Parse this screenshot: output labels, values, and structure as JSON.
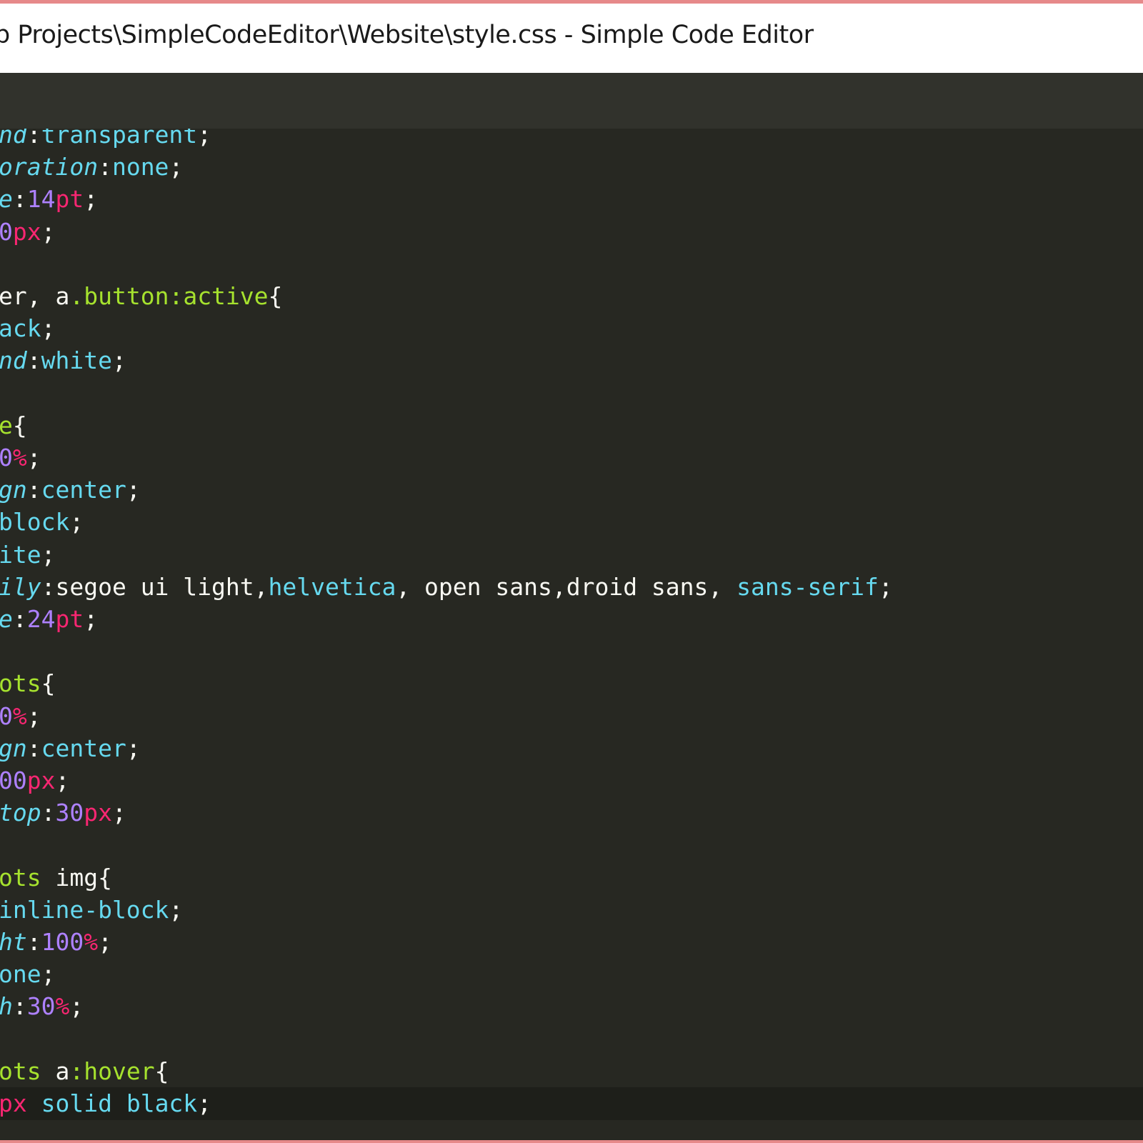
{
  "window": {
    "title": "p Projects\\SimpleCodeEditor\\Website\\style.css - Simple Code Editor"
  },
  "editor": {
    "language": "css",
    "theme_colors": {
      "background": "#272822",
      "foreground": "#f8f8f2",
      "property": "#66d9ef",
      "number": "#ae81ff",
      "unit": "#f92672",
      "selector": "#a6e22e",
      "current_line": "#1e1f1a",
      "window_border": "#e6898a"
    },
    "lines": [
      {
        "tokens": [
          {
            "t": "nd",
            "k": "prop-italic"
          },
          {
            "t": ":",
            "k": "punct"
          },
          {
            "t": "transparent",
            "k": "value"
          },
          {
            "t": ";",
            "k": "punct"
          }
        ]
      },
      {
        "tokens": [
          {
            "t": "oration",
            "k": "prop-italic"
          },
          {
            "t": ":",
            "k": "punct"
          },
          {
            "t": "none",
            "k": "value"
          },
          {
            "t": ";",
            "k": "punct"
          }
        ]
      },
      {
        "tokens": [
          {
            "t": "e",
            "k": "prop-italic"
          },
          {
            "t": ":",
            "k": "punct"
          },
          {
            "t": "14",
            "k": "num"
          },
          {
            "t": "pt",
            "k": "unit"
          },
          {
            "t": ";",
            "k": "punct"
          }
        ]
      },
      {
        "tokens": [
          {
            "t": "0",
            "k": "num"
          },
          {
            "t": "px",
            "k": "unit"
          },
          {
            "t": ";",
            "k": "punct"
          }
        ]
      },
      {
        "tokens": []
      },
      {
        "tokens": [
          {
            "t": "er",
            "k": "plain"
          },
          {
            "t": ", ",
            "k": "punct"
          },
          {
            "t": "a",
            "k": "plain"
          },
          {
            "t": ".button",
            "k": "selector"
          },
          {
            "t": ":active",
            "k": "selector"
          },
          {
            "t": "{",
            "k": "punct"
          }
        ]
      },
      {
        "tokens": [
          {
            "t": "ack",
            "k": "value"
          },
          {
            "t": ";",
            "k": "punct"
          }
        ]
      },
      {
        "tokens": [
          {
            "t": "nd",
            "k": "prop-italic"
          },
          {
            "t": ":",
            "k": "punct"
          },
          {
            "t": "white",
            "k": "value"
          },
          {
            "t": ";",
            "k": "punct"
          }
        ]
      },
      {
        "tokens": []
      },
      {
        "tokens": [
          {
            "t": "e",
            "k": "selector"
          },
          {
            "t": "{",
            "k": "punct"
          }
        ]
      },
      {
        "tokens": [
          {
            "t": "0",
            "k": "num"
          },
          {
            "t": "%",
            "k": "unit"
          },
          {
            "t": ";",
            "k": "punct"
          }
        ]
      },
      {
        "tokens": [
          {
            "t": "gn",
            "k": "prop-italic"
          },
          {
            "t": ":",
            "k": "punct"
          },
          {
            "t": "center",
            "k": "value"
          },
          {
            "t": ";",
            "k": "punct"
          }
        ]
      },
      {
        "tokens": [
          {
            "t": "block",
            "k": "value"
          },
          {
            "t": ";",
            "k": "punct"
          }
        ]
      },
      {
        "tokens": [
          {
            "t": "ite",
            "k": "value"
          },
          {
            "t": ";",
            "k": "punct"
          }
        ]
      },
      {
        "tokens": [
          {
            "t": "ily",
            "k": "prop-italic"
          },
          {
            "t": ":",
            "k": "punct"
          },
          {
            "t": "segoe ui light,",
            "k": "plain"
          },
          {
            "t": "helvetica",
            "k": "value"
          },
          {
            "t": ", open sans,droid sans, ",
            "k": "plain"
          },
          {
            "t": "sans-serif",
            "k": "value"
          },
          {
            "t": ";",
            "k": "punct"
          }
        ]
      },
      {
        "tokens": [
          {
            "t": "e",
            "k": "prop-italic"
          },
          {
            "t": ":",
            "k": "punct"
          },
          {
            "t": "24",
            "k": "num"
          },
          {
            "t": "pt",
            "k": "unit"
          },
          {
            "t": ";",
            "k": "punct"
          }
        ]
      },
      {
        "tokens": []
      },
      {
        "tokens": [
          {
            "t": "ots",
            "k": "selector"
          },
          {
            "t": "{",
            "k": "punct"
          }
        ]
      },
      {
        "tokens": [
          {
            "t": "0",
            "k": "num"
          },
          {
            "t": "%",
            "k": "unit"
          },
          {
            "t": ";",
            "k": "punct"
          }
        ]
      },
      {
        "tokens": [
          {
            "t": "gn",
            "k": "prop-italic"
          },
          {
            "t": ":",
            "k": "punct"
          },
          {
            "t": "center",
            "k": "value"
          },
          {
            "t": ";",
            "k": "punct"
          }
        ]
      },
      {
        "tokens": [
          {
            "t": "00",
            "k": "num"
          },
          {
            "t": "px",
            "k": "unit"
          },
          {
            "t": ";",
            "k": "punct"
          }
        ]
      },
      {
        "tokens": [
          {
            "t": "top",
            "k": "prop-italic"
          },
          {
            "t": ":",
            "k": "punct"
          },
          {
            "t": "30",
            "k": "num"
          },
          {
            "t": "px",
            "k": "unit"
          },
          {
            "t": ";",
            "k": "punct"
          }
        ]
      },
      {
        "tokens": []
      },
      {
        "tokens": [
          {
            "t": "ots",
            "k": "selector"
          },
          {
            "t": " img",
            "k": "plain"
          },
          {
            "t": "{",
            "k": "punct"
          }
        ]
      },
      {
        "tokens": [
          {
            "t": "inline-block",
            "k": "value"
          },
          {
            "t": ";",
            "k": "punct"
          }
        ]
      },
      {
        "tokens": [
          {
            "t": "ht",
            "k": "prop-italic"
          },
          {
            "t": ":",
            "k": "punct"
          },
          {
            "t": "100",
            "k": "num"
          },
          {
            "t": "%",
            "k": "unit"
          },
          {
            "t": ";",
            "k": "punct"
          }
        ]
      },
      {
        "tokens": [
          {
            "t": "one",
            "k": "value"
          },
          {
            "t": ";",
            "k": "punct"
          }
        ]
      },
      {
        "tokens": [
          {
            "t": "h",
            "k": "prop-italic"
          },
          {
            "t": ":",
            "k": "punct"
          },
          {
            "t": "30",
            "k": "num"
          },
          {
            "t": "%",
            "k": "unit"
          },
          {
            "t": ";",
            "k": "punct"
          }
        ]
      },
      {
        "tokens": []
      },
      {
        "tokens": [
          {
            "t": "ots",
            "k": "selector"
          },
          {
            "t": " a",
            "k": "plain"
          },
          {
            "t": ":hover",
            "k": "selector"
          },
          {
            "t": "{",
            "k": "punct"
          }
        ]
      },
      {
        "tokens": [
          {
            "t": "px",
            "k": "unit"
          },
          {
            "t": " solid ",
            "k": "value"
          },
          {
            "t": "black",
            "k": "value"
          },
          {
            "t": ";",
            "k": "punct"
          }
        ],
        "current": true
      }
    ]
  }
}
